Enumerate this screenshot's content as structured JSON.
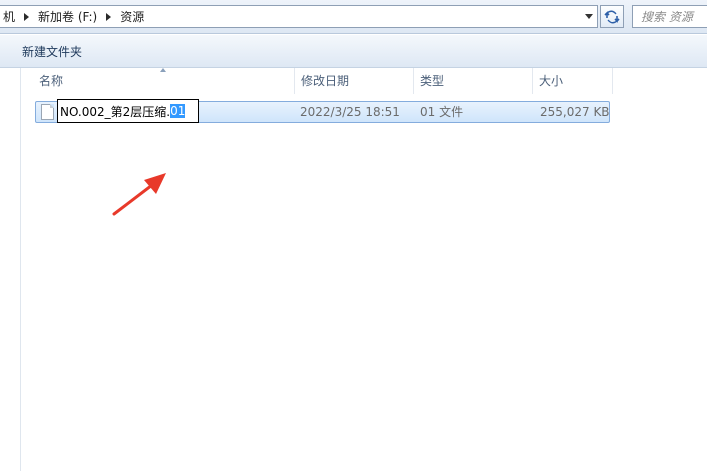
{
  "address": {
    "crumbs": [
      "机",
      "新加卷 (F:)",
      "资源"
    ]
  },
  "search": {
    "placeholder": "搜索 资源"
  },
  "toolbar": {
    "new_folder_label": "新建文件夹"
  },
  "columns": [
    {
      "label": "名称"
    },
    {
      "label": "修改日期"
    },
    {
      "label": "类型"
    },
    {
      "label": "大小"
    }
  ],
  "file": {
    "name_base": "NO.002_第2层压缩.",
    "name_selected": "01",
    "modified": "2022/3/25 18:51",
    "type": "01 文件",
    "size": "255,027 KB"
  },
  "colors": {
    "selection": "#3399ff",
    "arrow": "#e8392a"
  }
}
